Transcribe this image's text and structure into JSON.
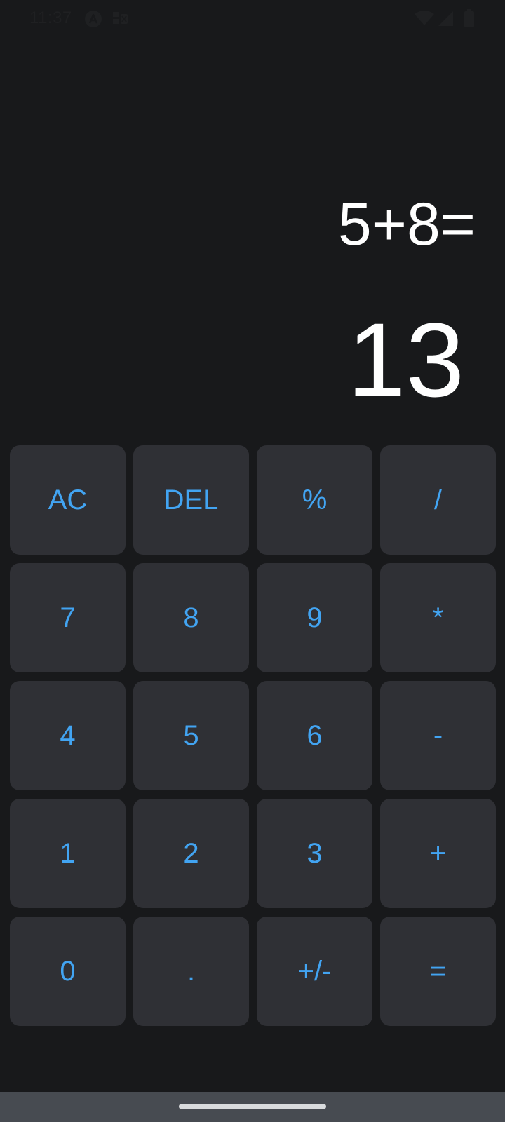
{
  "status_bar": {
    "time": "11:37",
    "icons": [
      "app-a-icon",
      "app-notification-icon",
      "wifi-icon",
      "signal-icon",
      "battery-icon"
    ]
  },
  "display": {
    "expression": "5+8=",
    "result": "13"
  },
  "keypad": {
    "keys": [
      "AC",
      "DEL",
      "%",
      "/",
      "7",
      "8",
      "9",
      "*",
      "4",
      "5",
      "6",
      "-",
      "1",
      "2",
      "3",
      "+",
      "0",
      ".",
      "+/-",
      "="
    ]
  },
  "colors": {
    "background": "#18191b",
    "key_background": "#2f3035",
    "key_text": "#42a4f2",
    "display_text": "#ffffff",
    "nav_bar": "#474b51"
  }
}
